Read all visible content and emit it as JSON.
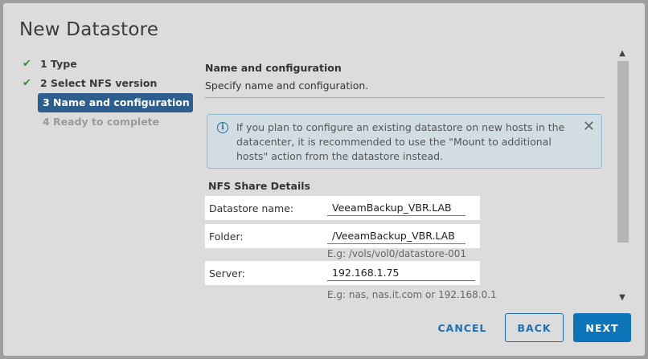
{
  "dialog": {
    "title": "New Datastore"
  },
  "steps": [
    {
      "label": "1 Type",
      "state": "complete"
    },
    {
      "label": "2 Select NFS version",
      "state": "complete"
    },
    {
      "label": "3 Name and configuration",
      "state": "active"
    },
    {
      "label": "4 Ready to complete",
      "state": "disabled"
    }
  ],
  "section": {
    "title": "Name and configuration",
    "subtitle": "Specify name and configuration."
  },
  "alert": {
    "text": "If you plan to configure an existing datastore on new hosts in the datacenter, it is recommended to use the \"Mount to additional hosts\" action from the datastore instead.",
    "close_symbol": "✕"
  },
  "nfs": {
    "title": "NFS Share Details",
    "datastore_name": {
      "label": "Datastore name:",
      "value": "VeeamBackup_VBR.LAB"
    },
    "folder": {
      "label": "Folder:",
      "value": "/VeeamBackup_VBR.LAB",
      "hint": "E.g: /vols/vol0/datastore-001"
    },
    "server": {
      "label": "Server:",
      "value": "192.168.1.75",
      "hint": "E.g: nas, nas.it.com or 192.168.0.1"
    }
  },
  "scrollbar": {
    "up": "▲",
    "down": "▼"
  },
  "buttons": {
    "cancel": "CANCEL",
    "back": "BACK",
    "next": "NEXT"
  },
  "colors": {
    "accent": "#0c74b7",
    "active_step": "#2e5e8e",
    "check": "#3a8c3a",
    "alert_bg": "#d2dde3",
    "alert_border": "#8fbbd3"
  }
}
